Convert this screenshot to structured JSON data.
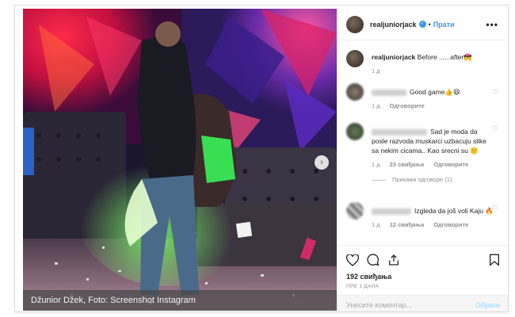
{
  "post": {
    "username": "realjuniorjack",
    "follow_label": "Прати",
    "more_label": "•••",
    "caption_text": "Before ......after",
    "caption_emoji": "💏",
    "caption_time": "1 д",
    "photo_caption": "Džunior Džek, Foto: Screenshot Instagram",
    "next_label": "›"
  },
  "comments": [
    {
      "text": "Good game👍😆",
      "time": "1 д",
      "reply_label": "Одговорите"
    },
    {
      "text": "Sad je moda da posle razvoda muskarci uzbacuju slike sa nekim cicama.. Kao srecni su 🙂",
      "time": "1 д",
      "likes": "23 свиђања",
      "reply_label": "Одговорите",
      "view_replies": "Прикажи одговоре (1)"
    },
    {
      "text": "Izgleda da još voli Kaju 🔥",
      "time": "1 д",
      "likes": "12 свиђања",
      "reply_label": "Одговорите"
    }
  ],
  "actions": {
    "likes_count": "192 свиђања",
    "time_ago": "ПРЕ 1 ДАНА",
    "comment_placeholder": "Унесите коментар...",
    "post_label": "Објави"
  },
  "icons": [
    "heart-icon",
    "comment-icon",
    "share-icon",
    "bookmark-icon",
    "verified-icon",
    "more-icon",
    "chevron-right-icon"
  ],
  "colors": {
    "accent": "#3897f0",
    "muted": "#8e8e8e",
    "border": "#dbdbdb"
  }
}
